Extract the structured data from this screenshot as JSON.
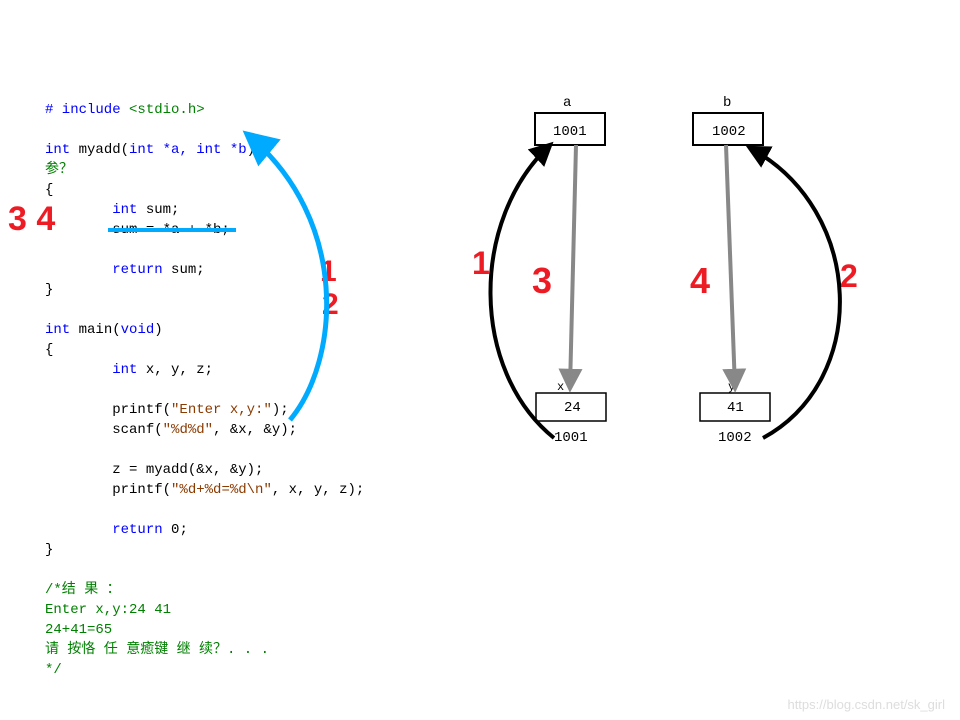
{
  "code": {
    "include": "# include ",
    "stdio": "<stdio.h>",
    "fn_sig_int": "int",
    "fn_sig_name": " myadd(",
    "fn_sig_params": "int *a, int *b",
    "fn_sig_close": ")",
    "param_note": "参？",
    "lbrace1": "{",
    "int_sum_kw": "int",
    "int_sum_rest": " sum;",
    "sum_expr": "sum = *a + *b;",
    "return_kw": "return",
    "return_rest": " sum;",
    "rbrace1": "}",
    "main_int": "int",
    "main_name": " main(",
    "main_void": "void",
    "main_close": ")",
    "lbrace2": "{",
    "xyz_int": "int",
    "xyz_rest": " x, y, z;",
    "printf1_a": "printf(",
    "printf1_s": "\"Enter x,y:\"",
    "printf1_b": ");",
    "scanf_a": "scanf(",
    "scanf_s": "\"%d%d\"",
    "scanf_b": ", &x, &y);",
    "z_call": "z = myadd(&x, &y);",
    "printf2_a": "printf(",
    "printf2_s": "\"%d+%d=%d\\n\"",
    "printf2_b": ", x, y, z);",
    "return0_kw": "return",
    "return0_rest": " 0;",
    "rbrace2": "}",
    "result_header": "/*结 果 ：",
    "result_l1": "Enter x,y:24 41",
    "result_l2": "24+41=65",
    "result_l3": "请 按恪 任 意癒键 继 续？. . .",
    "result_close": "*/"
  },
  "annotations": {
    "left34": "3 4",
    "curve1": "1",
    "curve2": "2",
    "d1": "1",
    "d2": "2",
    "d3": "3",
    "d4": "4"
  },
  "diagram": {
    "a": "a",
    "b": "b",
    "addr_a": "1001",
    "addr_b": "1002",
    "x": "x",
    "y": "y",
    "x_val": "24",
    "y_val": "41",
    "x_addr": "1001",
    "y_addr": "1002"
  },
  "watermark": "https://blog.csdn.net/sk_girl"
}
